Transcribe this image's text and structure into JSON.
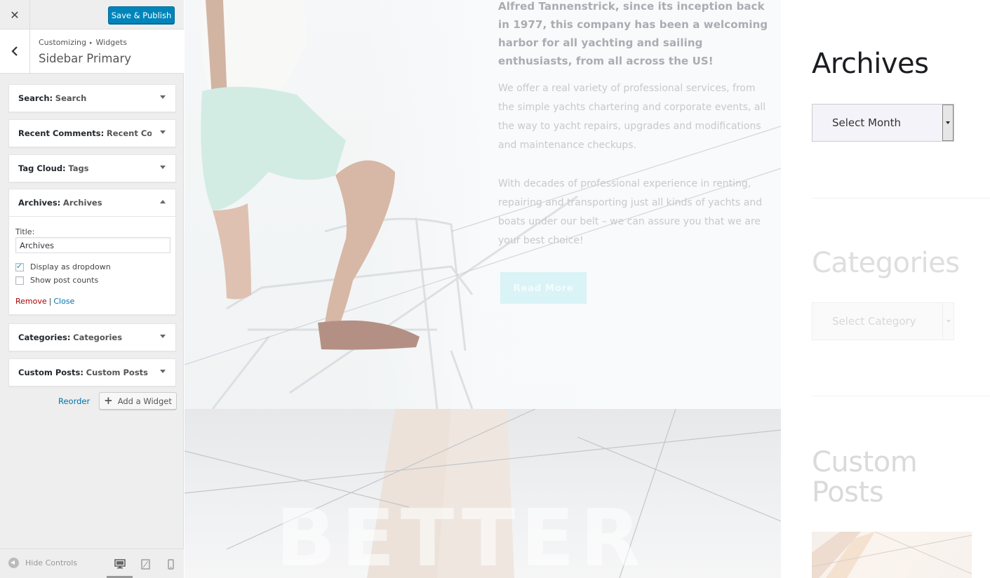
{
  "customizer": {
    "close_icon": "close-icon",
    "save_label": "Save & Publish",
    "breadcrumb": {
      "parent": "Customizing",
      "child": "Widgets"
    },
    "section_title": "Sidebar Primary",
    "widgets": [
      {
        "type": "Search:",
        "name": "Search",
        "state": "collapsed"
      },
      {
        "type": "Recent Comments:",
        "name": "Recent Com...",
        "state": "collapsed"
      },
      {
        "type": "Tag Cloud:",
        "name": "Tags",
        "state": "collapsed"
      },
      {
        "type": "Archives:",
        "name": "Archives",
        "state": "expanded"
      },
      {
        "type": "Categories:",
        "name": "Categories",
        "state": "collapsed"
      },
      {
        "type": "Custom Posts:",
        "name": "Custom Posts",
        "state": "collapsed"
      }
    ],
    "archives_form": {
      "title_label": "Title:",
      "title_value": "Archives",
      "display_dropdown_label": "Display as dropdown",
      "display_dropdown_checked": true,
      "show_counts_label": "Show post counts",
      "show_counts_checked": false,
      "remove_label": "Remove",
      "separator": "|",
      "close_label": "Close"
    },
    "reorder_label": "Reorder",
    "add_widget_label": "Add a Widget",
    "footer": {
      "hide_controls_label": "Hide Controls",
      "devices": [
        "desktop-icon",
        "tablet-icon",
        "mobile-icon"
      ],
      "active_device": "desktop"
    },
    "colors": {
      "primary": "#0085ba",
      "link": "#0073aa",
      "remove": "#aa0000"
    }
  },
  "preview": {
    "hero_lead": "Alfred Tannenstrick, since its inception back in 1977, this company has been a welcoming harbor for all yachting and sailing enthusiasts, from all across the US!",
    "hero_p1": "We offer a real variety of professional services, from the simple yachts chartering and corporate events, all the way to yacht repairs, upgrades and modifications and maintenance checkups.",
    "hero_p2": "With decades of professional experience in renting, repairing and transporting just all kinds of yachts and boats under our belt – we can assure you that we are your best choice!",
    "read_more_label": "Read More",
    "background_word": "BETTER",
    "sidebar": {
      "archives_heading": "Archives",
      "month_select_value": "Select Month",
      "categories_heading": "Categories",
      "category_select_value": "Select Category",
      "custom_posts_heading": "Custom Posts"
    },
    "colors": {
      "accent": "#d9f3f6",
      "heading": "#1b1d21"
    }
  }
}
